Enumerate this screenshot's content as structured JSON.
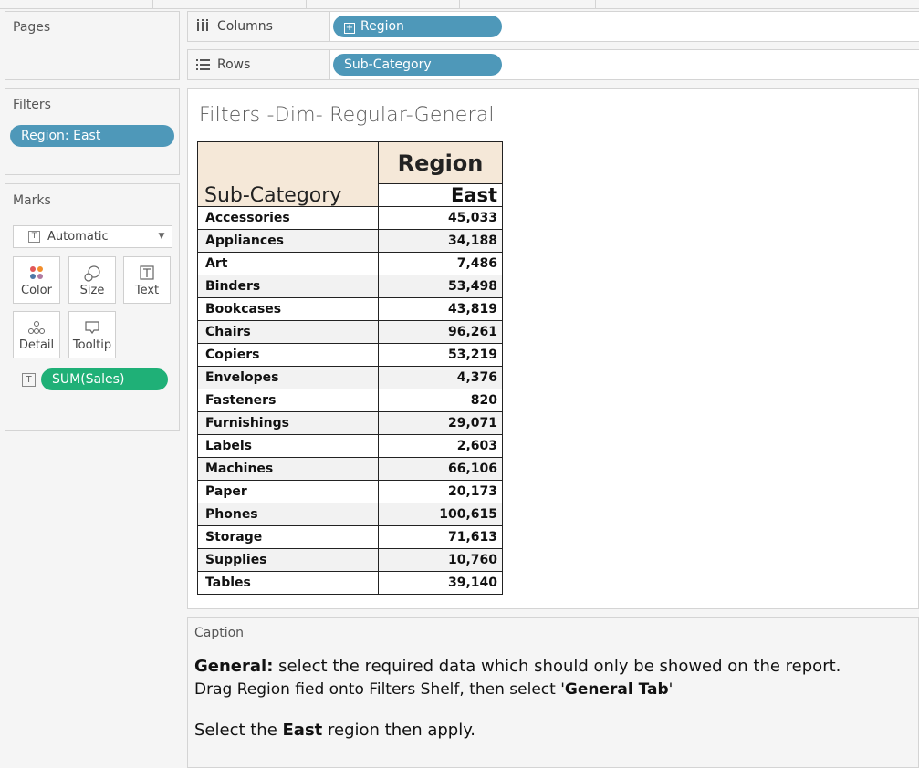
{
  "panels": {
    "pages_title": "Pages",
    "filters_title": "Filters",
    "filter_pill": "Region: East",
    "marks_title": "Marks",
    "mark_type": "Automatic",
    "mark_buttons": {
      "color": "Color",
      "size": "Size",
      "text": "Text",
      "detail": "Detail",
      "tooltip": "Tooltip"
    },
    "measure_pill": "SUM(Sales)"
  },
  "shelves": {
    "columns_label": "Columns",
    "columns_pill": "Region",
    "rows_label": "Rows",
    "rows_pill": "Sub-Category"
  },
  "viz": {
    "title": "Filters -Dim- Regular-General",
    "row_header": "Sub-Category",
    "column_header": "Region",
    "column_value": "East",
    "rows": [
      {
        "category": "Accessories",
        "value": "45,033"
      },
      {
        "category": "Appliances",
        "value": "34,188"
      },
      {
        "category": "Art",
        "value": "7,486"
      },
      {
        "category": "Binders",
        "value": "53,498"
      },
      {
        "category": "Bookcases",
        "value": "43,819"
      },
      {
        "category": "Chairs",
        "value": "96,261"
      },
      {
        "category": "Copiers",
        "value": "53,219"
      },
      {
        "category": "Envelopes",
        "value": "4,376"
      },
      {
        "category": "Fasteners",
        "value": "820"
      },
      {
        "category": "Furnishings",
        "value": "29,071"
      },
      {
        "category": "Labels",
        "value": "2,603"
      },
      {
        "category": "Machines",
        "value": "66,106"
      },
      {
        "category": "Paper",
        "value": "20,173"
      },
      {
        "category": "Phones",
        "value": "100,615"
      },
      {
        "category": "Storage",
        "value": "71,613"
      },
      {
        "category": "Supplies",
        "value": "10,760"
      },
      {
        "category": "Tables",
        "value": "39,140"
      }
    ]
  },
  "caption": {
    "title": "Caption",
    "line1_bold": "General:",
    "line1_rest": " select the required data which should only be showed on the report.",
    "line2_start": "Drag Region fied onto Filters Shelf, then select '",
    "line2_bold": "General Tab",
    "line2_end": "'",
    "line3_start": "Select the ",
    "line3_bold": "East",
    "line3_end": " region then apply."
  },
  "colors": {
    "dimension_pill": "#4e98b9",
    "measure_pill": "#1fb077",
    "header_bg": "#f5e8d8"
  }
}
